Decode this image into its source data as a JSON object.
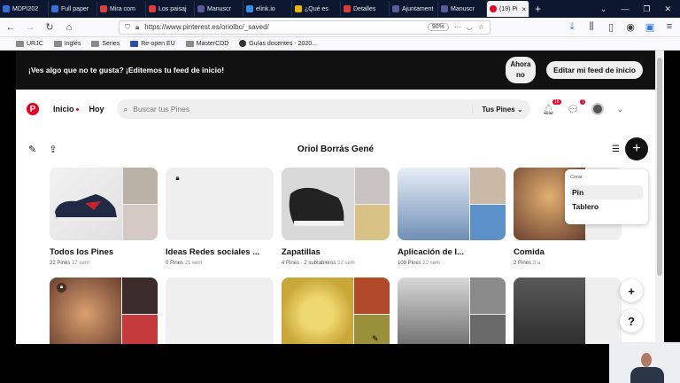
{
  "browser": {
    "tabs": [
      {
        "label": "MDPI202",
        "color": "#3b6fd8"
      },
      {
        "label": "Full paper",
        "color": "#3b6fd8"
      },
      {
        "label": "Mira com",
        "color": "#e23b3b"
      },
      {
        "label": "Los paisaj",
        "color": "#e23b3b"
      },
      {
        "label": "Manuscr",
        "color": "#5a5a9a"
      },
      {
        "label": "elink.io",
        "color": "#3a8ee6"
      },
      {
        "label": "¿Qué es",
        "color": "#e6b800"
      },
      {
        "label": "Detalles",
        "color": "#e23b3b"
      },
      {
        "label": "Ajuntament",
        "color": "#5a5a9a"
      },
      {
        "label": "Manuscr",
        "color": "#5a5a9a"
      },
      {
        "label": "(19) Pi",
        "color": "#e60023",
        "active": true
      }
    ],
    "new_tab": "+",
    "url": "https://www.pinterest.es/oriolbc/_saved/",
    "zoom": "90%",
    "bookmarks": [
      "URJC",
      "Inglés",
      "Series",
      "Re-open EU",
      "MasterCDD",
      "Guías docentes - 2020..."
    ]
  },
  "banner": {
    "text": "¡Ves algo que no te gusta? ¡Editemos tu feed de inicio!",
    "now_button": "Ahora no",
    "edit_button": "Editar mi feed de inicio"
  },
  "header": {
    "logo": "P",
    "nav_home": "Inicio",
    "nav_today": "Hoy",
    "search_placeholder": "Buscar tus Pines",
    "search_scope": "Tus Pines",
    "notifications_count": "18",
    "messages_count": "1"
  },
  "profile": {
    "name": "Oriol Borrás Gené"
  },
  "boards": [
    {
      "title": "Todos los Pines",
      "meta": "22 Pines",
      "time": "27 sem",
      "colors": [
        "#e9e9e9",
        "#b8b3a6",
        "#d4c9c5"
      ]
    },
    {
      "title": "Ideas Redes sociales ...",
      "meta": "0 Pines",
      "time": "21 sem",
      "colors": [
        "#efefef",
        "#efefef",
        "#efefef"
      ]
    },
    {
      "title": "Zapatillas",
      "meta": "4 Pines · 2 subtableros",
      "time": "22 sem",
      "colors": [
        "#2b2b2b",
        "#c9c3c3",
        "#d8c285"
      ]
    },
    {
      "title": "Aplicación de I...",
      "meta": "109 Pines",
      "time": "22 sem",
      "colors": [
        "#6f8fb8",
        "#cbb9a8",
        "#5a91c9"
      ]
    },
    {
      "title": "Comida",
      "meta": "2 Pines",
      "time": "3 a",
      "colors": [
        "#8a5a3a",
        "#efefef",
        "#efefef"
      ]
    }
  ],
  "boards_row2": [
    {
      "colors": [
        "#6b4030",
        "#3b2b2b",
        "#c53b3b"
      ]
    },
    {
      "colors": [
        "#efefef",
        "#efefef",
        "#efefef"
      ]
    },
    {
      "colors": [
        "#e2c65a",
        "#b04a2a",
        "#9a8f3a"
      ]
    },
    {
      "colors": [
        "#bdbdbd",
        "#8a8a8a",
        "#6a6a6a"
      ]
    },
    {
      "colors": [
        "#4a4a4a",
        "#efefef",
        "#efefef"
      ]
    }
  ],
  "dropdown": {
    "heading": "Crear",
    "items": [
      "Pin",
      "Tablero"
    ]
  },
  "float_buttons": {
    "add": "+",
    "help": "?"
  }
}
